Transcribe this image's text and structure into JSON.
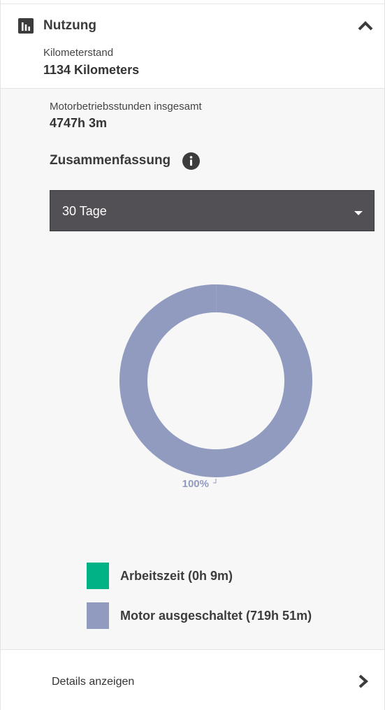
{
  "section": {
    "title": "Nutzung",
    "icon": "bar-chart-icon"
  },
  "odometer": {
    "label": "Kilometerstand",
    "value": "1134 Kilometers"
  },
  "engine_hours": {
    "label": "Motorbetriebsstunden insgesamt",
    "value": "4747h 3m"
  },
  "summary": {
    "title": "Zusammenfassung",
    "info_icon": "info-icon",
    "period": "30 Tage"
  },
  "chart_data": {
    "type": "pie",
    "donut": true,
    "slices": [
      {
        "label": "Arbeitszeit (0h 9m)",
        "minutes": 9,
        "color": "#00b386"
      },
      {
        "label": "Motor ausgeschaltet (719h 51m)",
        "minutes": 43191,
        "color": "#919bbf"
      }
    ],
    "data_labels": [
      "100%"
    ],
    "legend": "bottom"
  },
  "legend": {
    "items": [
      {
        "label": "Arbeitszeit (0h 9m)",
        "color": "#00b386"
      },
      {
        "label": "Motor ausgeschaltet (719h 51m)",
        "color": "#919bbf"
      }
    ]
  },
  "footer": {
    "details_label": "Details anzeigen"
  }
}
